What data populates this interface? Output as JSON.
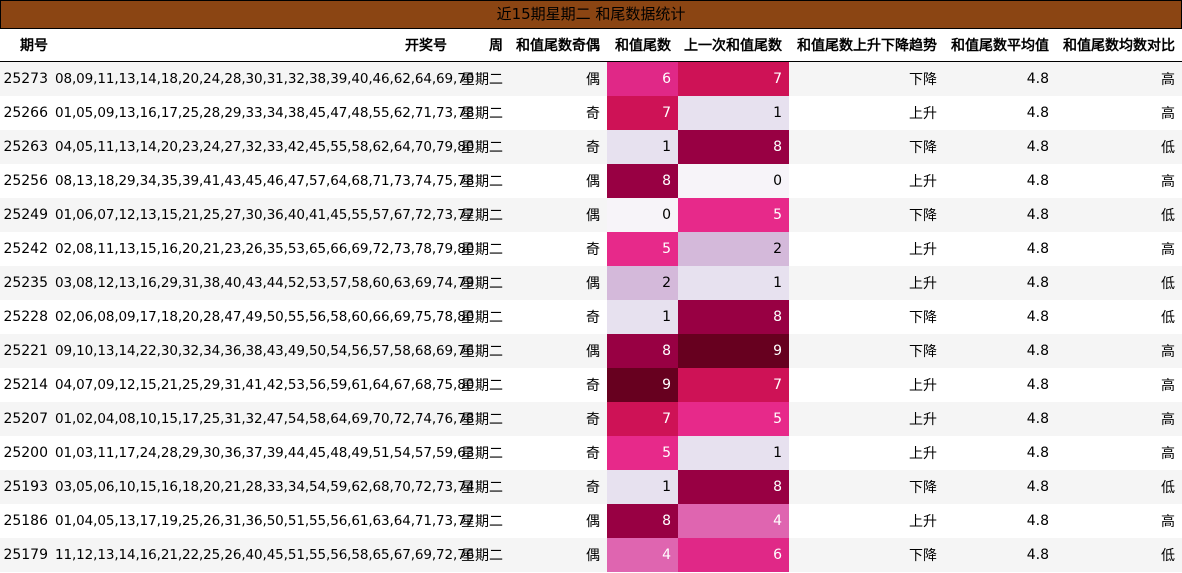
{
  "title": "近15期星期二 和尾数据统计",
  "columns": [
    "期号",
    "开奖号",
    "周",
    "和值尾数奇偶",
    "和值尾数",
    "上一次和值尾数",
    "和值尾数上升下降趋势",
    "和值尾数平均值",
    "和值尾数均数对比"
  ],
  "heat_colors": {
    "0": "#f7f4f9",
    "1": "#e7e1ef",
    "2": "#d4b9da",
    "4": "#df65b0",
    "5": "#e7298a",
    "6": "#e02887",
    "7": "#ce1256",
    "8": "#980043",
    "9": "#67001f"
  },
  "rows": [
    {
      "issue": "25273",
      "numbers": "08,09,11,13,14,18,20,24,28,30,31,32,38,39,40,46,62,64,69,70",
      "weekday": "星期二",
      "parity": "偶",
      "tail": "6",
      "prev_tail": "7",
      "trend": "下降",
      "avg": "4.8",
      "compare": "高"
    },
    {
      "issue": "25266",
      "numbers": "01,05,09,13,16,17,25,28,29,33,34,38,45,47,48,55,62,71,73,78",
      "weekday": "星期二",
      "parity": "奇",
      "tail": "7",
      "prev_tail": "1",
      "trend": "上升",
      "avg": "4.8",
      "compare": "高"
    },
    {
      "issue": "25263",
      "numbers": "04,05,11,13,14,20,23,24,27,32,33,42,45,55,58,62,64,70,79,80",
      "weekday": "星期二",
      "parity": "奇",
      "tail": "1",
      "prev_tail": "8",
      "trend": "下降",
      "avg": "4.8",
      "compare": "低"
    },
    {
      "issue": "25256",
      "numbers": "08,13,18,29,34,35,39,41,43,45,46,47,57,64,68,71,73,74,75,78",
      "weekday": "星期二",
      "parity": "偶",
      "tail": "8",
      "prev_tail": "0",
      "trend": "上升",
      "avg": "4.8",
      "compare": "高"
    },
    {
      "issue": "25249",
      "numbers": "01,06,07,12,13,15,21,25,27,30,36,40,41,45,55,57,67,72,73,77",
      "weekday": "星期二",
      "parity": "偶",
      "tail": "0",
      "prev_tail": "5",
      "trend": "下降",
      "avg": "4.8",
      "compare": "低"
    },
    {
      "issue": "25242",
      "numbers": "02,08,11,13,15,16,20,21,23,26,35,53,65,66,69,72,73,78,79,80",
      "weekday": "星期二",
      "parity": "奇",
      "tail": "5",
      "prev_tail": "2",
      "trend": "上升",
      "avg": "4.8",
      "compare": "高"
    },
    {
      "issue": "25235",
      "numbers": "03,08,12,13,16,29,31,38,40,43,44,52,53,57,58,60,63,69,74,79",
      "weekday": "星期二",
      "parity": "偶",
      "tail": "2",
      "prev_tail": "1",
      "trend": "上升",
      "avg": "4.8",
      "compare": "低"
    },
    {
      "issue": "25228",
      "numbers": "02,06,08,09,17,18,20,28,47,49,50,55,56,58,60,66,69,75,78,80",
      "weekday": "星期二",
      "parity": "奇",
      "tail": "1",
      "prev_tail": "8",
      "trend": "下降",
      "avg": "4.8",
      "compare": "低"
    },
    {
      "issue": "25221",
      "numbers": "09,10,13,14,22,30,32,34,36,38,43,49,50,54,56,57,58,68,69,76",
      "weekday": "星期二",
      "parity": "偶",
      "tail": "8",
      "prev_tail": "9",
      "trend": "下降",
      "avg": "4.8",
      "compare": "高"
    },
    {
      "issue": "25214",
      "numbers": "04,07,09,12,15,21,25,29,31,41,42,53,56,59,61,64,67,68,75,80",
      "weekday": "星期二",
      "parity": "奇",
      "tail": "9",
      "prev_tail": "7",
      "trend": "上升",
      "avg": "4.8",
      "compare": "高"
    },
    {
      "issue": "25207",
      "numbers": "01,02,04,08,10,15,17,25,31,32,47,54,58,64,69,70,72,74,76,78",
      "weekday": "星期二",
      "parity": "奇",
      "tail": "7",
      "prev_tail": "5",
      "trend": "上升",
      "avg": "4.8",
      "compare": "高"
    },
    {
      "issue": "25200",
      "numbers": "01,03,11,17,24,28,29,30,36,37,39,44,45,48,49,51,54,57,59,63",
      "weekday": "星期二",
      "parity": "奇",
      "tail": "5",
      "prev_tail": "1",
      "trend": "上升",
      "avg": "4.8",
      "compare": "高"
    },
    {
      "issue": "25193",
      "numbers": "03,05,06,10,15,16,18,20,21,28,33,34,54,59,62,68,70,72,73,74",
      "weekday": "星期二",
      "parity": "奇",
      "tail": "1",
      "prev_tail": "8",
      "trend": "下降",
      "avg": "4.8",
      "compare": "低"
    },
    {
      "issue": "25186",
      "numbers": "01,04,05,13,17,19,25,26,31,36,50,51,55,56,61,63,64,71,73,77",
      "weekday": "星期二",
      "parity": "偶",
      "tail": "8",
      "prev_tail": "4",
      "trend": "上升",
      "avg": "4.8",
      "compare": "高"
    },
    {
      "issue": "25179",
      "numbers": "11,12,13,14,16,21,22,25,26,40,45,51,55,56,58,65,67,69,72,76",
      "weekday": "星期二",
      "parity": "偶",
      "tail": "4",
      "prev_tail": "6",
      "trend": "下降",
      "avg": "4.8",
      "compare": "低"
    }
  ]
}
